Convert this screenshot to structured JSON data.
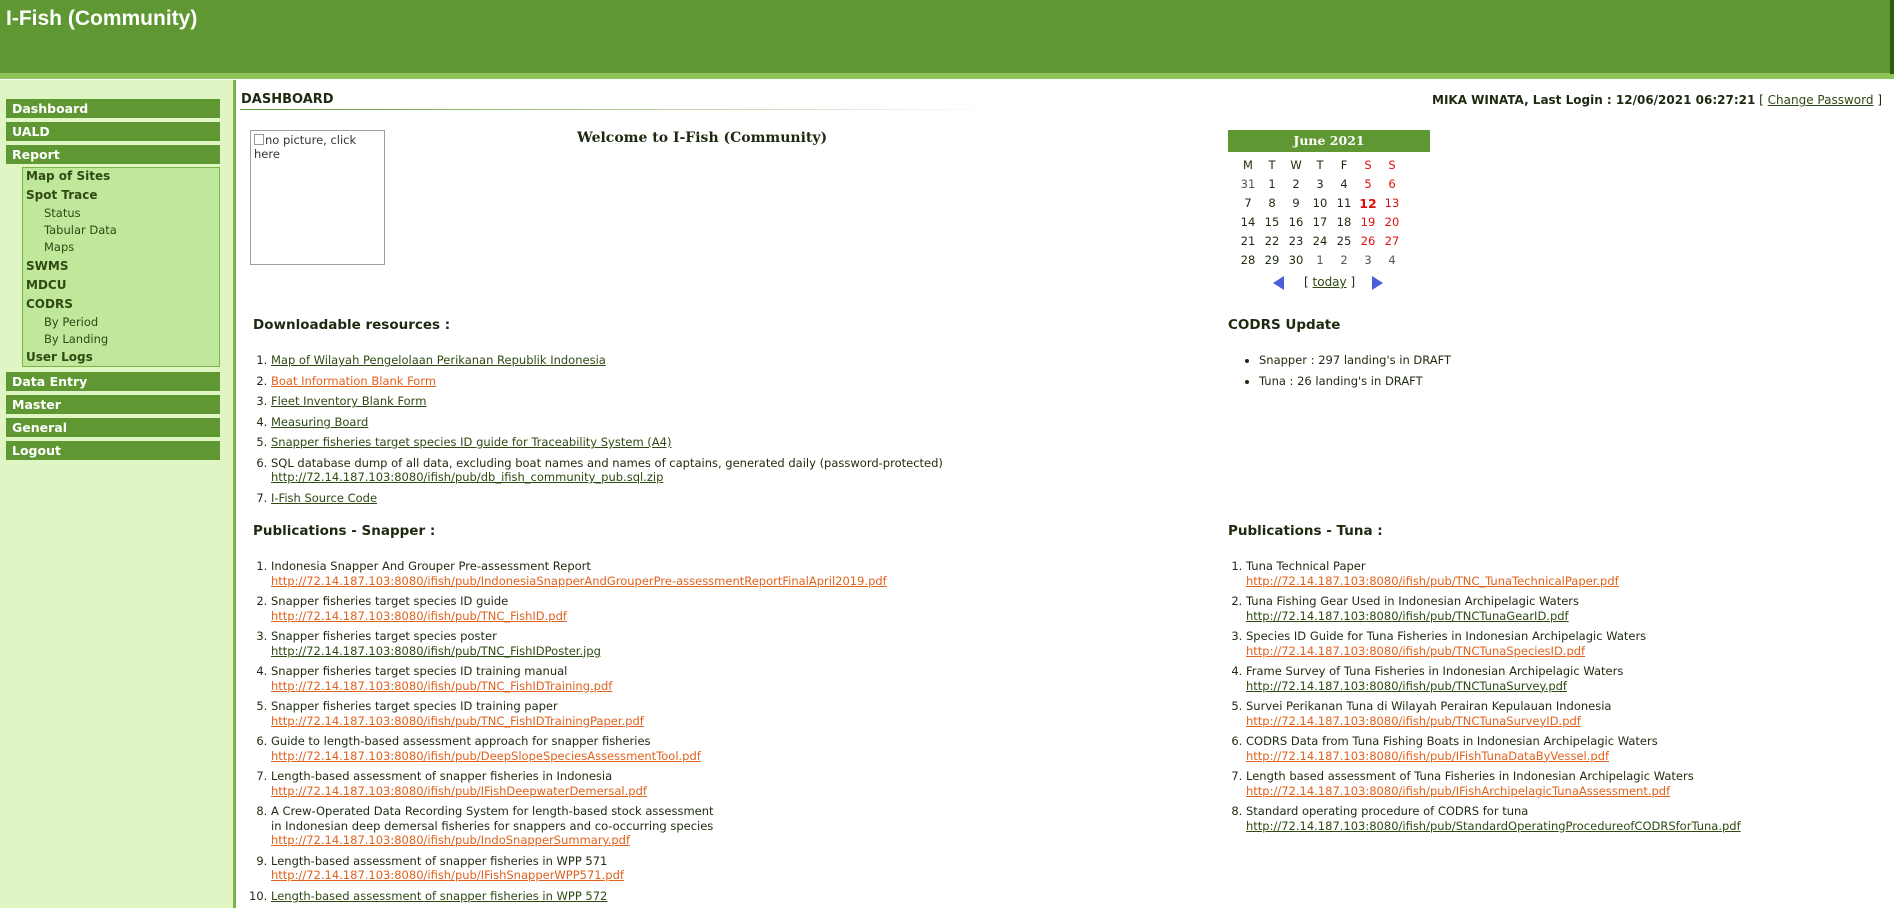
{
  "app": {
    "title": "I-Fish (Community)"
  },
  "sidebar": {
    "items": [
      {
        "label": "Dashboard"
      },
      {
        "label": "UALD"
      },
      {
        "label": "Report"
      },
      {
        "label": "Data Entry"
      },
      {
        "label": "Master"
      },
      {
        "label": "General"
      },
      {
        "label": "Logout"
      }
    ],
    "report_submenu": {
      "map_of_sites": "Map of Sites",
      "spot_trace": "Spot Trace",
      "status": "Status",
      "tabular_data": "Tabular Data",
      "maps": "Maps",
      "swms": "SWMS",
      "mdcu": "MDCU",
      "codrs": "CODRS",
      "by_period": "By Period",
      "by_landing": "By Landing",
      "user_logs": "User Logs"
    }
  },
  "header": {
    "page_title": "DASHBOARD",
    "user": "MIKA WINATA",
    "last_login_label": ", Last Login : 12/06/2021 06:27:21",
    "bracket_open": "[",
    "change_password": "Change Password",
    "bracket_close": "]"
  },
  "picture": {
    "alt": "no picture, click here"
  },
  "welcome": "Welcome to I-Fish (Community)",
  "calendar": {
    "month": "June 2021",
    "weekdays": [
      "M",
      "T",
      "W",
      "T",
      "F",
      "S",
      "S"
    ],
    "rows": [
      [
        "31",
        "1",
        "2",
        "3",
        "4",
        "5",
        "6"
      ],
      [
        "7",
        "8",
        "9",
        "10",
        "11",
        "12",
        "13"
      ],
      [
        "14",
        "15",
        "16",
        "17",
        "18",
        "19",
        "20"
      ],
      [
        "21",
        "22",
        "23",
        "24",
        "25",
        "26",
        "27"
      ],
      [
        "28",
        "29",
        "30",
        "1",
        "2",
        "3",
        "4"
      ]
    ],
    "today_label": "today",
    "today_left": "[",
    "today_right": "]"
  },
  "downloadable": {
    "title": "Downloadable resources :",
    "items": [
      {
        "text": "Map of Wilayah Pengelolaan Perikanan Republik Indonesia"
      },
      {
        "text": "Boat Information Blank Form"
      },
      {
        "text": "Fleet Inventory Blank Form"
      },
      {
        "text": "Measuring Board"
      },
      {
        "text": "Snapper fisheries target species ID guide for Traceability System (A4)"
      },
      {
        "text": "SQL database dump of all data, excluding boat names and names of captains, generated daily (password-protected)",
        "link": "http://72.14.187.103:8080/ifish/pub/db_ifish_community_pub.sql.zip"
      },
      {
        "text": "I-Fish Source Code"
      }
    ]
  },
  "codrs_update": {
    "title": "CODRS Update",
    "items": [
      "Snapper : 297 landing's in DRAFT",
      "Tuna : 26 landing's in DRAFT"
    ]
  },
  "pub_snapper": {
    "title": "Publications - Snapper :",
    "items": [
      {
        "text": "Indonesia Snapper And Grouper Pre-assessment Report",
        "link": "http://72.14.187.103:8080/ifish/pub/IndonesiaSnapperAndGrouperPre-assessmentReportFinalApril2019.pdf"
      },
      {
        "text": "Snapper fisheries target species ID guide",
        "link": "http://72.14.187.103:8080/ifish/pub/TNC_FishID.pdf"
      },
      {
        "text": "Snapper fisheries target species poster",
        "link": "http://72.14.187.103:8080/ifish/pub/TNC_FishIDPoster.jpg"
      },
      {
        "text": "Snapper fisheries target species ID training manual",
        "link": "http://72.14.187.103:8080/ifish/pub/TNC_FishIDTraining.pdf"
      },
      {
        "text": "Snapper fisheries target species ID training paper",
        "link": "http://72.14.187.103:8080/ifish/pub/TNC_FishIDTrainingPaper.pdf"
      },
      {
        "text": "Guide to length-based assessment approach for snapper fisheries",
        "link": "http://72.14.187.103:8080/ifish/pub/DeepSlopeSpeciesAssessmentTool.pdf"
      },
      {
        "text": "Length-based assessment of snapper fisheries in Indonesia",
        "link": "http://72.14.187.103:8080/ifish/pub/IFishDeepwaterDemersal.pdf"
      },
      {
        "text": "A Crew-Operated Data Recording System for length-based stock assessment",
        "text2": "in Indonesian deep demersal fisheries for snappers and co-occurring species",
        "link": "http://72.14.187.103:8080/ifish/pub/IndoSnapperSummary.pdf"
      },
      {
        "text": "Length-based assessment of snapper fisheries in WPP 571",
        "link": "http://72.14.187.103:8080/ifish/pub/IFishSnapperWPP571.pdf"
      },
      {
        "text": "Length-based assessment of snapper fisheries in WPP 572"
      }
    ]
  },
  "pub_tuna": {
    "title": "Publications - Tuna :",
    "items": [
      {
        "text": "Tuna Technical Paper",
        "link": "http://72.14.187.103:8080/ifish/pub/TNC_TunaTechnicalPaper.pdf"
      },
      {
        "text": "Tuna Fishing Gear Used in Indonesian Archipelagic Waters",
        "link": "http://72.14.187.103:8080/ifish/pub/TNCTunaGearID.pdf"
      },
      {
        "text": "Species ID Guide for Tuna Fisheries in Indonesian Archipelagic Waters",
        "link": "http://72.14.187.103:8080/ifish/pub/TNCTunaSpeciesID.pdf"
      },
      {
        "text": "Frame Survey of Tuna Fisheries in Indonesian Archipelagic Waters",
        "link": "http://72.14.187.103:8080/ifish/pub/TNCTunaSurvey.pdf"
      },
      {
        "text": "Survei Perikanan Tuna di Wilayah Perairan Kepulauan Indonesia",
        "link": "http://72.14.187.103:8080/ifish/pub/TNCTunaSurveyID.pdf"
      },
      {
        "text": "CODRS Data from Tuna Fishing Boats in Indonesian Archipelagic Waters",
        "link": "http://72.14.187.103:8080/ifish/pub/IFishTunaDataByVessel.pdf"
      },
      {
        "text": "Length based assessment of Tuna Fisheries in Indonesian Archipelagic Waters",
        "link": "http://72.14.187.103:8080/ifish/pub/IFishArchipelagicTunaAssessment.pdf"
      },
      {
        "text": "Standard operating procedure of CODRS for tuna",
        "link": "http://72.14.187.103:8080/ifish/pub/StandardOperatingProcedureofCODRSforTuna.pdf"
      }
    ]
  },
  "colors": {
    "header_green": "#5f9733",
    "sidebar_bg": "#dff5c4",
    "link_orange": "#e0621e",
    "link_green": "#2e4a12",
    "weekend_red": "#e01010"
  }
}
